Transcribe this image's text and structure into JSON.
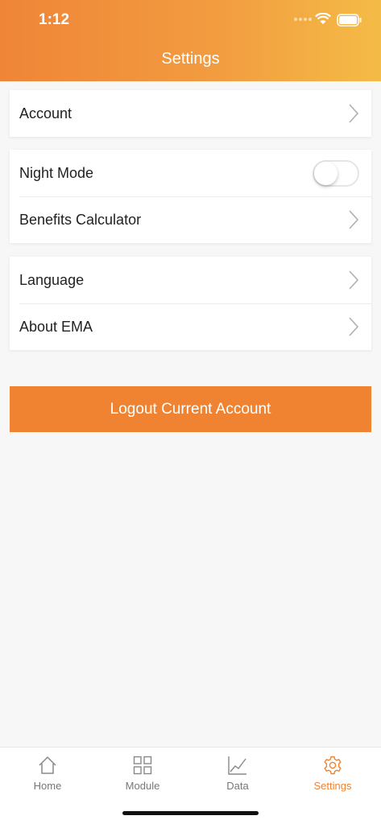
{
  "status_bar": {
    "time": "1:12"
  },
  "header": {
    "title": "Settings"
  },
  "groups": {
    "account": {
      "label": "Account"
    },
    "night_mode": {
      "label": "Night Mode",
      "enabled": false
    },
    "benefits": {
      "label": "Benefits Calculator"
    },
    "language": {
      "label": "Language"
    },
    "about": {
      "label": "About EMA"
    }
  },
  "logout": {
    "label": "Logout Current Account"
  },
  "tabs": [
    {
      "label": "Home",
      "icon": "home-icon"
    },
    {
      "label": "Module",
      "icon": "grid-icon"
    },
    {
      "label": "Data",
      "icon": "chart-icon"
    },
    {
      "label": "Settings",
      "icon": "gear-icon",
      "active": true
    }
  ],
  "colors": {
    "accent": "#f08332",
    "header_start": "#ef8537",
    "header_end": "#f4bb46"
  }
}
